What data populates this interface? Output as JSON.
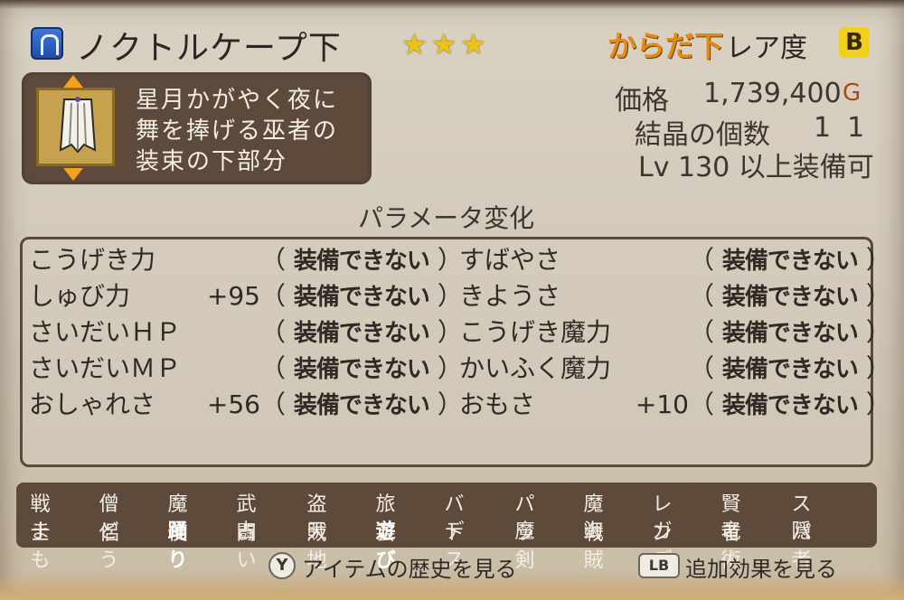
{
  "header": {
    "category_icon": "robe-lower-icon",
    "title": "ノクトルケープ下",
    "stars": "★★★",
    "slot": "からだ下",
    "rarity_label": "レア度",
    "rarity": "B"
  },
  "description": {
    "lines": [
      "星月かがやく夜に",
      "舞を捧げる巫者の",
      "装束の下部分"
    ]
  },
  "info": {
    "price_label": "価格",
    "price_value": "1,739,400",
    "gold_unit": "G",
    "crystal_label": "結晶の個数",
    "crystal_value": "11",
    "level_text": "Lv 130 以上装備可"
  },
  "params": {
    "title": "パラメータ変化",
    "left": [
      {
        "name": "こうげき力",
        "bonus": "",
        "status": "装備できない"
      },
      {
        "name": "しゅび力",
        "bonus": "+95",
        "status": "装備できない"
      },
      {
        "name": "さいだいＨＰ",
        "bonus": "",
        "status": "装備できない"
      },
      {
        "name": "さいだいＭＰ",
        "bonus": "",
        "status": "装備できない"
      },
      {
        "name": "おしゃれさ",
        "bonus": "+56",
        "status": "装備できない"
      }
    ],
    "right": [
      {
        "name": "すばやさ",
        "bonus": "",
        "status": "装備できない"
      },
      {
        "name": "きようさ",
        "bonus": "",
        "status": "装備できない"
      },
      {
        "name": "こうげき魔力",
        "bonus": "",
        "status": "装備できない"
      },
      {
        "name": "かいふく魔力",
        "bonus": "",
        "status": "装備できない"
      },
      {
        "name": "おもさ",
        "bonus": "+10",
        "status": "装備できない"
      }
    ]
  },
  "jobs": {
    "row1": [
      "戦士",
      "僧侶",
      "魔使",
      "武闘",
      "盗賊",
      "旅芸",
      "バト",
      "パラ",
      "魔戦",
      "レン",
      "賢者",
      "スパ"
    ],
    "row2": [
      "まも",
      "どう",
      "踊り",
      "占い",
      "天地",
      "遊び",
      "デス",
      "魔剣",
      "海賊",
      "ガデ",
      "竜術",
      "隠者"
    ],
    "highlighted_row2": [
      "踊り",
      "遊び"
    ]
  },
  "footer": {
    "history_button": "Y",
    "history_label": "アイテムの歴史を見る",
    "extra_button": "LB",
    "extra_label": "追加効果を見る"
  },
  "colors": {
    "star": "#e9c21a",
    "slot": "#e48a14",
    "rarity_badge": "#f0cf1e",
    "panel": "#5d4a3b"
  }
}
